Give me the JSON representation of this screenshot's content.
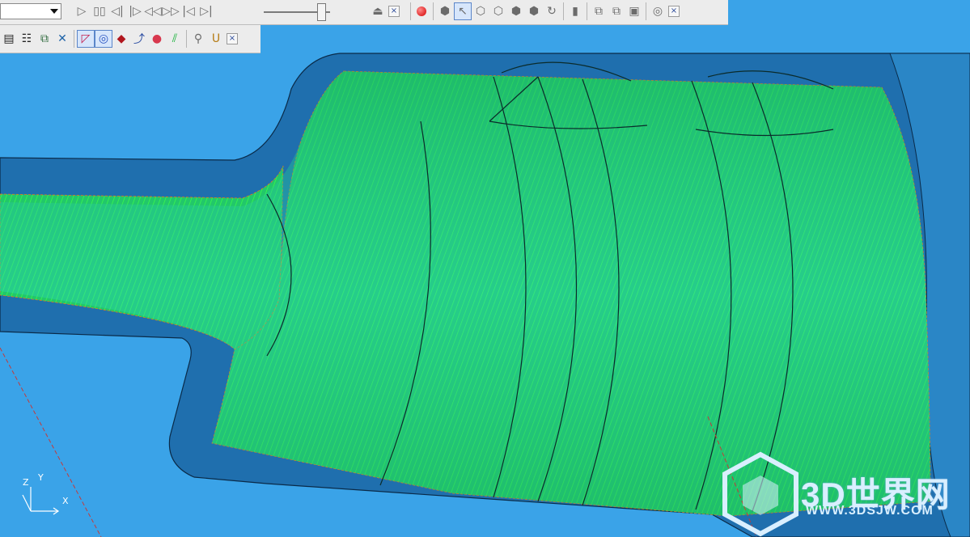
{
  "viewport": {
    "axis_labels": {
      "x": "X",
      "y": "Y",
      "z": "Z"
    }
  },
  "watermark": {
    "brand": "3D世界网",
    "url": "WWW.3DSJW.COM"
  },
  "toolbar_top": {
    "close_glyph": "×",
    "icons": [
      "play-icon",
      "pause-icon",
      "step-back-icon",
      "step-forward-icon",
      "rewind-icon",
      "fast-forward-icon",
      "goto-start-icon",
      "goto-end-icon",
      "eject-icon",
      "record-icon"
    ]
  },
  "toolbar_right": {
    "close_glyph": "×"
  },
  "toolbar_bottom": {
    "close_glyph": "×"
  },
  "colors": {
    "background": "#3aa3e8",
    "part_dark": "#1f6fae",
    "toolpath_green": "#27e43f",
    "toolbar": "#ececec"
  }
}
